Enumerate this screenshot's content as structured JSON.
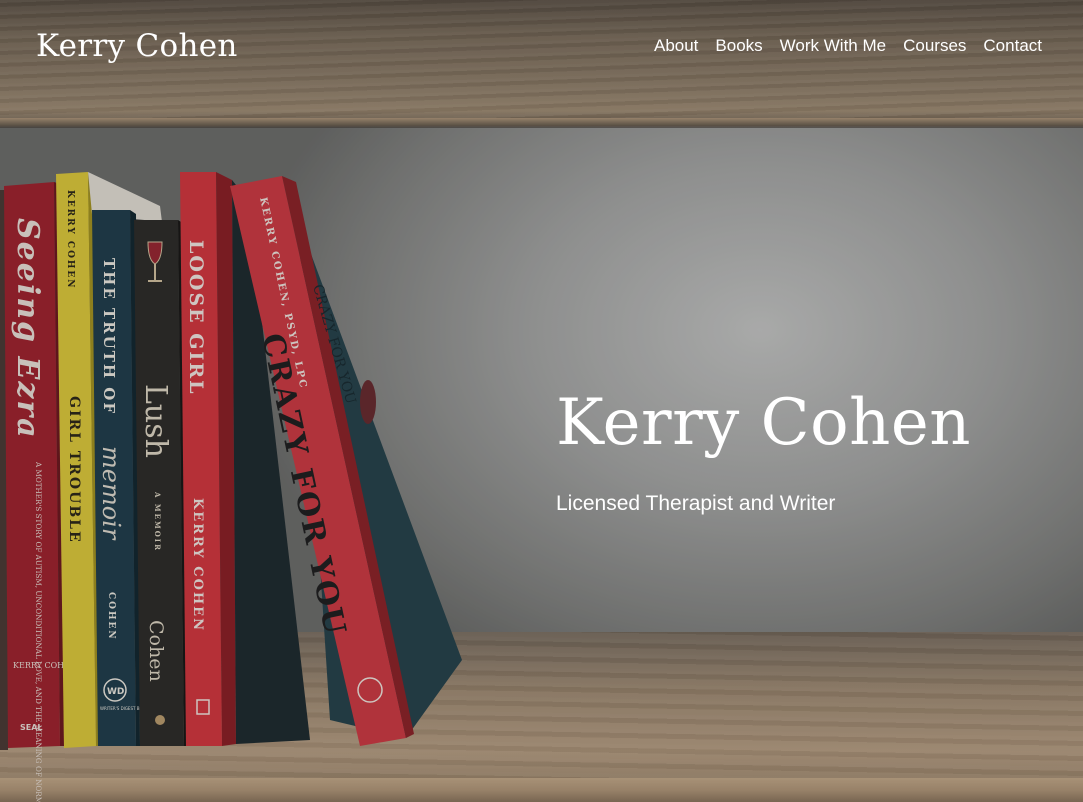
{
  "site": {
    "brand": "Kerry Cohen"
  },
  "nav": {
    "items": [
      {
        "label": "About"
      },
      {
        "label": "Books"
      },
      {
        "label": "Work With Me"
      },
      {
        "label": "Courses"
      },
      {
        "label": "Contact"
      }
    ]
  },
  "hero": {
    "title": "Kerry Cohen",
    "subtitle": "Licensed Therapist and Writer"
  },
  "books": {
    "seeing_ezra": {
      "title": "Seeing Ezra",
      "tagline": "A MOTHER'S STORY OF AUTISM, UNCONDITIONAL LOVE, AND THE MEANING OF NORMAL",
      "author": "KERRY COHEN",
      "publisher": "SEAL"
    },
    "girl_trouble": {
      "title": "GIRL TROUBLE",
      "author": "KERRY COHEN"
    },
    "truth_of_memoir": {
      "title_a": "THE TRUTH OF",
      "title_b": "memoir",
      "author": "COHEN",
      "publisher": "WRITER'S DIGEST BOOKS",
      "publisher_mark": "WD"
    },
    "lush": {
      "title": "Lush",
      "subtitle": "A MEMOIR",
      "author": "Cohen"
    },
    "loose_girl": {
      "title": "LOOSE GIRL",
      "author": "KERRY COHEN"
    },
    "crazy_for_you": {
      "title": "CRAZY FOR YOU",
      "author": "KERRY COHEN, PSYD, LPC"
    }
  },
  "colors": {
    "text": "#ffffff",
    "seal_red": "#a3222c",
    "yellow_spine": "#e3cf3a",
    "teal_spine": "#1f3e4c",
    "dark_spine": "#2c2b28",
    "red_spine": "#d8363e",
    "cover_teal": "#25434b"
  }
}
